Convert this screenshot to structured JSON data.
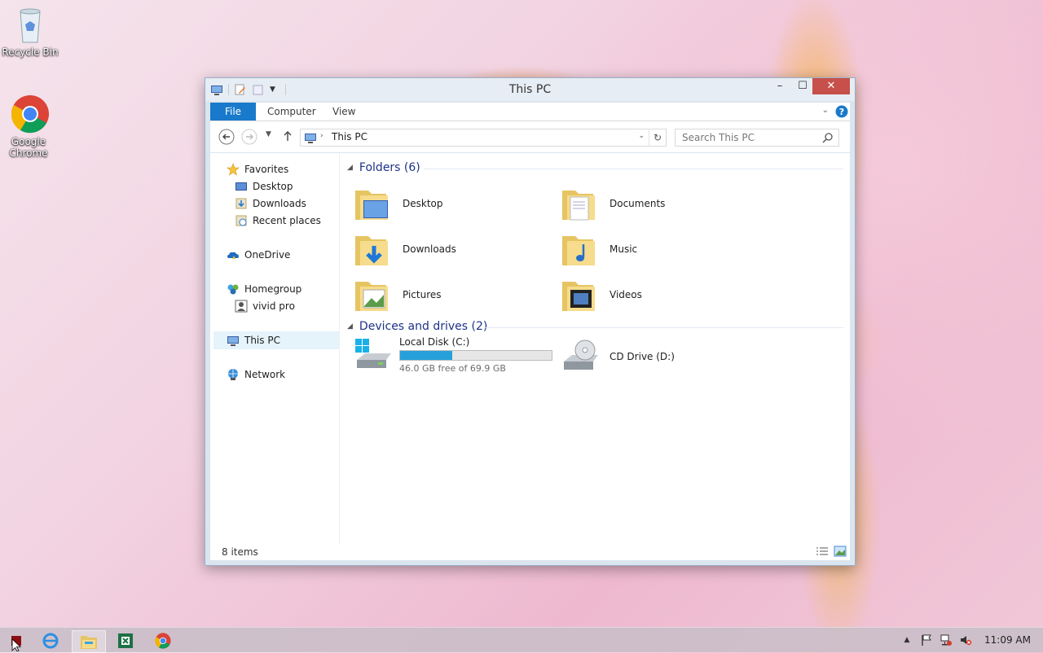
{
  "desktop": {
    "icons": [
      {
        "label": "Recycle Bin"
      },
      {
        "label": "Google Chrome"
      }
    ]
  },
  "window": {
    "title": "This PC",
    "ribbon_tabs": {
      "file": "File",
      "computer": "Computer",
      "view": "View"
    },
    "address": {
      "path": "This PC"
    },
    "search": {
      "placeholder": "Search This PC"
    },
    "nav": {
      "favorites": "Favorites",
      "desktop": "Desktop",
      "downloads": "Downloads",
      "recent": "Recent places",
      "onedrive": "OneDrive",
      "homegroup": "Homegroup",
      "user": "vivid pro",
      "thispc": "This PC",
      "network": "Network"
    },
    "folders_header": "Folders (6)",
    "folders": [
      "Desktop",
      "Documents",
      "Downloads",
      "Music",
      "Pictures",
      "Videos"
    ],
    "drives_header": "Devices and drives (2)",
    "drives": {
      "local": {
        "name": "Local Disk (C:)",
        "free": "46.0 GB free of 69.9 GB",
        "used_fraction": 0.342
      },
      "cd": {
        "name": "CD Drive (D:)"
      }
    },
    "status": "8 items"
  },
  "taskbar": {
    "clock": "11:09 AM"
  },
  "colors": {
    "accent": "#1979ca",
    "selection": "#e5f3fb",
    "group_header": "#1e3287",
    "close": "#c7504a",
    "drive_bar": "#26a0da"
  }
}
